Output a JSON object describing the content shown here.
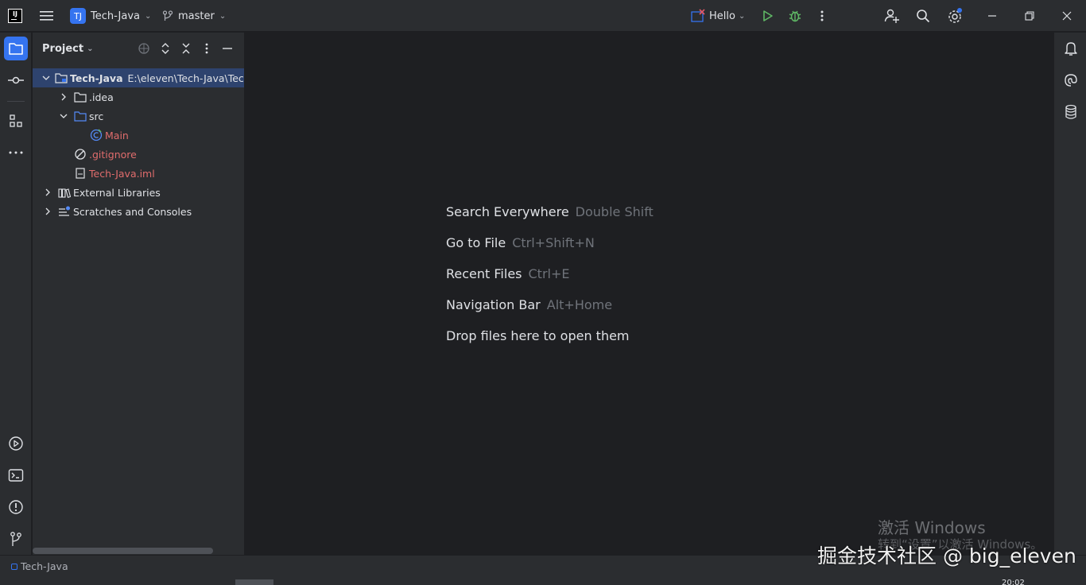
{
  "titlebar": {
    "logo_text": "IJ",
    "project_badge": "TJ",
    "project_name": "Tech-Java",
    "branch": "master",
    "run_config": "Hello"
  },
  "project_panel": {
    "title": "Project",
    "tree": [
      {
        "label": "Tech-Java",
        "path": "E:\\eleven\\Tech-Java\\Tech"
      },
      {
        "label": ".idea"
      },
      {
        "label": "src"
      },
      {
        "label": "Main"
      },
      {
        "label": ".gitignore"
      },
      {
        "label": "Tech-Java.iml"
      },
      {
        "label": "External Libraries"
      },
      {
        "label": "Scratches and Consoles"
      }
    ]
  },
  "editor": {
    "hints": [
      {
        "label": "Search Everywhere",
        "shortcut": "Double Shift"
      },
      {
        "label": "Go to File",
        "shortcut": "Ctrl+Shift+N"
      },
      {
        "label": "Recent Files",
        "shortcut": "Ctrl+E"
      },
      {
        "label": "Navigation Bar",
        "shortcut": "Alt+Home"
      },
      {
        "label": "Drop files here to open them",
        "shortcut": ""
      }
    ]
  },
  "statusbar": {
    "project": "Tech-Java"
  },
  "watermarks": {
    "activate_title": "激活 Windows",
    "activate_sub": "转到“设置”以激活 Windows。",
    "juejin": "掘金技术社区 @ big_eleven",
    "time": "20:02"
  },
  "colors": {
    "accent": "#3574f0",
    "run": "#5fb865",
    "panel_bg": "#2b2d30",
    "editor_bg": "#1e1f22",
    "error_file": "#e06c6c"
  }
}
